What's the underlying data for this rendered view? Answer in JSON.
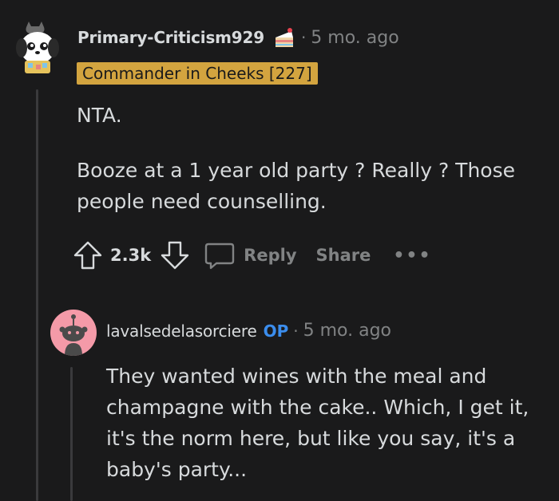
{
  "comment": {
    "username": "Primary-Criticism929",
    "separator": "·",
    "time": "5 mo. ago",
    "flair": "Commander in Cheeks [227]",
    "body": [
      "NTA.",
      "Booze at a 1 year old party ? Really ? Those people need counselling."
    ],
    "score": "2.3k",
    "reply_label": "Reply",
    "share_label": "Share",
    "more_label": "•••",
    "award_icon": "cake-icon"
  },
  "reply": {
    "username": "lavalsedelasorciere",
    "op_badge": "OP",
    "separator": "·",
    "time": "5 mo. ago",
    "body": "They wanted wines with the meal and champagne with the cake.. Which, I get it, it's the norm here, but like you say, it's a baby's party..."
  },
  "colors": {
    "background": "#1a1a1b",
    "text": "#d7dadc",
    "muted": "#818384",
    "flair_bg": "#d3a43f",
    "op": "#3b8ded",
    "avatar_pink": "#f49aa8"
  }
}
